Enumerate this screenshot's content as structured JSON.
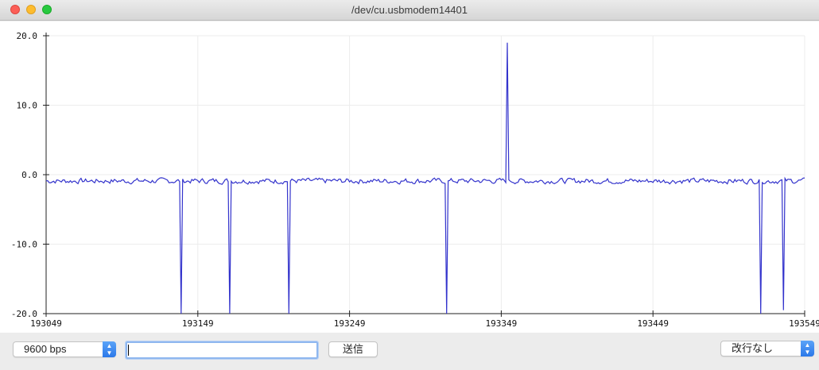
{
  "window": {
    "title": "/dev/cu.usbmodem14401"
  },
  "chart_data": {
    "type": "line",
    "y_ticks": [
      "20.0",
      "10.0",
      "0.0",
      "-10.0",
      "-20.0"
    ],
    "x_ticks": [
      "193049",
      "193149",
      "193249",
      "193349",
      "193449",
      "193549"
    ],
    "xlim": [
      193049,
      193549
    ],
    "ylim": [
      -20,
      20
    ],
    "grid": true,
    "line_color": "#3333cc",
    "series": [
      {
        "baseline": -0.9,
        "noise": 0.35,
        "spikes": [
          {
            "x": 193138,
            "y": -20.0
          },
          {
            "x": 193170,
            "y": -20.0
          },
          {
            "x": 193209,
            "y": -20.0
          },
          {
            "x": 193313,
            "y": -20.0
          },
          {
            "x": 193353,
            "y": 19.0
          },
          {
            "x": 193520,
            "y": -20.0
          },
          {
            "x": 193535,
            "y": -19.5
          }
        ]
      }
    ]
  },
  "bottom": {
    "baud": "9600 bps",
    "input_value": "",
    "send_label": "送信",
    "line_ending": "改行なし"
  }
}
